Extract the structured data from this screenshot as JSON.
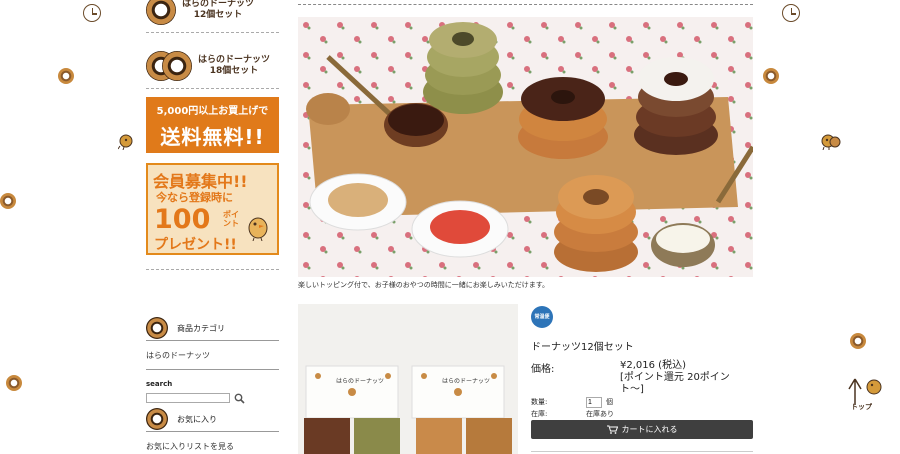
{
  "sidebar": {
    "set12_label_line1": "はらのドーナッツ",
    "set12_label_line2": "12個セット",
    "set18_label_line1": "はらのドーナッツ",
    "set18_label_line2": "18個セット",
    "free_shipping": {
      "line1": "5,000円以上お買上げで",
      "line2": "送料無料!!"
    },
    "member": {
      "line1": "会員募集中!!",
      "line2": "今なら登録時に",
      "points_num": "100",
      "points_unit_line1": "ポイ",
      "points_unit_line2": "ント",
      "line4": "プレゼント!!"
    },
    "category_title": "商品カテゴリ",
    "category_item": "はらのドーナッツ",
    "search_label": "search",
    "favorites_title": "お気に入り",
    "favorites_link": "お気に入りリストを見る"
  },
  "main": {
    "caption": "楽しいトッピング付で、お子様のおやつの時間に一緒にお楽しみいただけます。",
    "badge": "常温便",
    "product_name": "ドーナッツ12個セット",
    "price_label": "価格:",
    "price_value": "¥2,016 (税込)",
    "points_note": "[ポイント還元 20ポイント〜]",
    "qty_label": "数量:",
    "qty_value": "1",
    "qty_unit": "個",
    "stock_label": "在庫:",
    "stock_value": "在庫あり",
    "cart_button": "カートに入れる",
    "box_label": "はらのドーナッツ"
  },
  "totop": {
    "label": "トップ"
  },
  "colors": {
    "accent_orange": "#e07a1a",
    "cart_button_bg": "#3f3f3f",
    "badge_blue": "#2d74b8"
  },
  "icons": [
    "donut-icon",
    "clock-icon",
    "chick-icon",
    "search-icon",
    "cart-icon",
    "arrow-up-icon"
  ]
}
